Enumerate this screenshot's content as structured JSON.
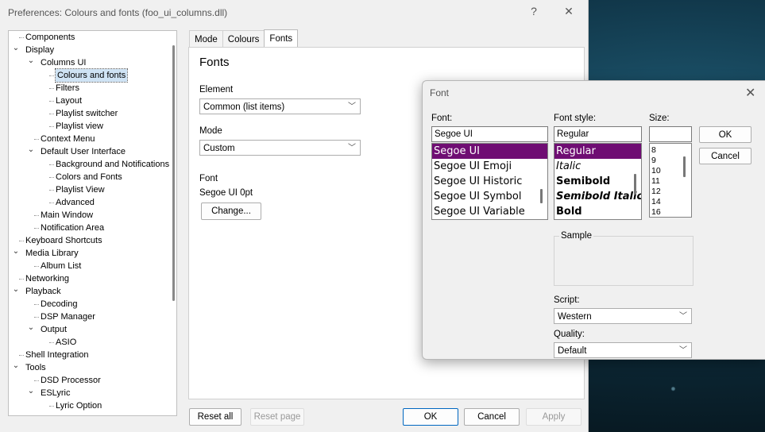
{
  "window": {
    "title": "Preferences: Colours and fonts (foo_ui_columns.dll)",
    "help": "?",
    "close": "✕"
  },
  "tree": [
    {
      "label": "Components",
      "depth": 0,
      "exp": ""
    },
    {
      "label": "Display",
      "depth": 0,
      "exp": "v"
    },
    {
      "label": "Columns UI",
      "depth": 1,
      "exp": "v"
    },
    {
      "label": "Colours and fonts",
      "depth": 2,
      "exp": "",
      "selected": true
    },
    {
      "label": "Filters",
      "depth": 2,
      "exp": ""
    },
    {
      "label": "Layout",
      "depth": 2,
      "exp": ""
    },
    {
      "label": "Playlist switcher",
      "depth": 2,
      "exp": ""
    },
    {
      "label": "Playlist view",
      "depth": 2,
      "exp": ""
    },
    {
      "label": "Context Menu",
      "depth": 1,
      "exp": ""
    },
    {
      "label": "Default User Interface",
      "depth": 1,
      "exp": "v"
    },
    {
      "label": "Background and Notifications",
      "depth": 2,
      "exp": ""
    },
    {
      "label": "Colors and Fonts",
      "depth": 2,
      "exp": ""
    },
    {
      "label": "Playlist View",
      "depth": 2,
      "exp": ""
    },
    {
      "label": "Advanced",
      "depth": 2,
      "exp": ""
    },
    {
      "label": "Main Window",
      "depth": 1,
      "exp": ""
    },
    {
      "label": "Notification Area",
      "depth": 1,
      "exp": ""
    },
    {
      "label": "Keyboard Shortcuts",
      "depth": 0,
      "exp": ""
    },
    {
      "label": "Media Library",
      "depth": 0,
      "exp": "v"
    },
    {
      "label": "Album List",
      "depth": 1,
      "exp": ""
    },
    {
      "label": "Networking",
      "depth": 0,
      "exp": ""
    },
    {
      "label": "Playback",
      "depth": 0,
      "exp": "v"
    },
    {
      "label": "Decoding",
      "depth": 1,
      "exp": ""
    },
    {
      "label": "DSP Manager",
      "depth": 1,
      "exp": ""
    },
    {
      "label": "Output",
      "depth": 1,
      "exp": "v"
    },
    {
      "label": "ASIO",
      "depth": 2,
      "exp": ""
    },
    {
      "label": "Shell Integration",
      "depth": 0,
      "exp": ""
    },
    {
      "label": "Tools",
      "depth": 0,
      "exp": "v"
    },
    {
      "label": "DSD Processor",
      "depth": 1,
      "exp": ""
    },
    {
      "label": "ESLyric",
      "depth": 1,
      "exp": "v"
    },
    {
      "label": "Lyric Option",
      "depth": 2,
      "exp": ""
    }
  ],
  "tabs": [
    "Mode",
    "Colours",
    "Fonts"
  ],
  "active_tab": "Fonts",
  "panel": {
    "heading": "Fonts",
    "element_label": "Element",
    "element_value": "Common (list items)",
    "mode_label": "Mode",
    "mode_value": "Custom",
    "font_label": "Font",
    "font_value": "Segoe UI 0pt",
    "change_button": "Change..."
  },
  "footer": {
    "reset_all": "Reset all",
    "reset_page": "Reset page",
    "ok": "OK",
    "cancel": "Cancel",
    "apply": "Apply"
  },
  "font_dialog": {
    "title": "Font",
    "close": "✕",
    "font_label": "Font:",
    "font_value": "Segoe UI",
    "fonts": [
      "Segoe UI",
      "Segoe UI Emoji",
      "Segoe UI Historic",
      "Segoe UI Symbol",
      "Segoe UI Variable"
    ],
    "style_label": "Font style:",
    "style_value": "Regular",
    "styles": [
      "Regular",
      "Italic",
      "Semibold",
      "Semibold Italic",
      "Bold"
    ],
    "size_label": "Size:",
    "size_value": "",
    "sizes": [
      "8",
      "9",
      "10",
      "11",
      "12",
      "14",
      "16"
    ],
    "ok": "OK",
    "cancel": "Cancel",
    "sample_label": "Sample",
    "script_label": "Script:",
    "script_value": "Western",
    "quality_label": "Quality:",
    "quality_value": "Default"
  },
  "colors": {
    "selection": "#6f0d73",
    "primary_border": "#0067c0"
  }
}
